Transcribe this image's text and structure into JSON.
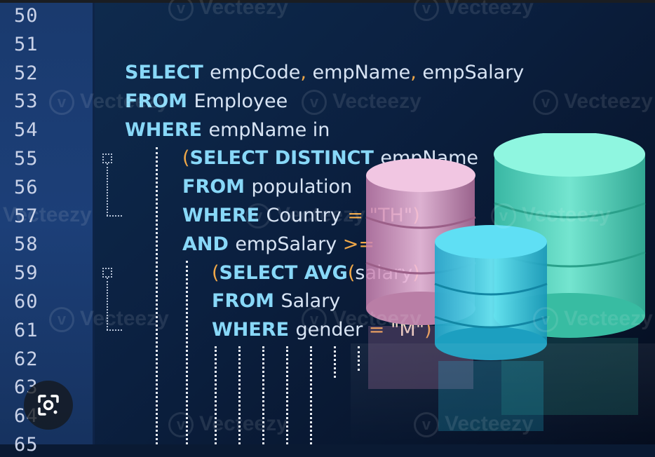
{
  "line_numbers": [
    "50",
    "51",
    "52",
    "53",
    "54",
    "55",
    "56",
    "57",
    "58",
    "59",
    "60",
    "61",
    "62",
    "63",
    "64",
    "65"
  ],
  "code_lines": [
    {
      "parts": [
        {
          "t": "SELECT ",
          "c": "kw"
        },
        {
          "t": "empCode",
          "c": "id"
        },
        {
          "t": ", ",
          "c": "op"
        },
        {
          "t": "empName",
          "c": "id"
        },
        {
          "t": ", ",
          "c": "op"
        },
        {
          "t": "empSalary",
          "c": "id"
        }
      ]
    },
    {
      "parts": [
        {
          "t": "FROM ",
          "c": "kw"
        },
        {
          "t": "Employee",
          "c": "id"
        }
      ]
    },
    {
      "parts": [
        {
          "t": "WHERE ",
          "c": "kw"
        },
        {
          "t": "empName in",
          "c": "id"
        }
      ]
    },
    {
      "parts": [
        {
          "t": "(",
          "c": "op"
        },
        {
          "t": "SELECT DISTINCT ",
          "c": "kw"
        },
        {
          "t": "empName",
          "c": "id"
        }
      ]
    },
    {
      "parts": [
        {
          "t": "FROM ",
          "c": "kw"
        },
        {
          "t": "population",
          "c": "id"
        }
      ]
    },
    {
      "parts": [
        {
          "t": "WHERE ",
          "c": "kw"
        },
        {
          "t": "Country ",
          "c": "id"
        },
        {
          "t": "= ",
          "c": "op"
        },
        {
          "t": "\"TH\"",
          "c": "str"
        },
        {
          "t": ")",
          "c": "op"
        }
      ]
    },
    {
      "parts": [
        {
          "t": "AND ",
          "c": "kw"
        },
        {
          "t": "empSalary ",
          "c": "id"
        },
        {
          "t": ">=",
          "c": "op"
        }
      ]
    },
    {
      "parts": [
        {
          "t": "(",
          "c": "op"
        },
        {
          "t": "SELECT AVG",
          "c": "kw"
        },
        {
          "t": "(",
          "c": "op"
        },
        {
          "t": "salary",
          "c": "id"
        },
        {
          "t": ")",
          "c": "op"
        }
      ]
    },
    {
      "parts": [
        {
          "t": "FROM ",
          "c": "kw"
        },
        {
          "t": "Salary",
          "c": "id"
        }
      ]
    },
    {
      "parts": [
        {
          "t": "WHERE ",
          "c": "kw"
        },
        {
          "t": "gender ",
          "c": "id"
        },
        {
          "t": "= ",
          "c": "op"
        },
        {
          "t": "\"M\"",
          "c": "str"
        },
        {
          "t": ")",
          "c": "op"
        }
      ]
    }
  ],
  "watermark": {
    "text": "Vecteezy",
    "logo_glyph": "v"
  },
  "icons": {
    "lens": "google-lens-icon",
    "fold": "fold-toggle-icon"
  },
  "colors": {
    "keyword": "#88d8f8",
    "operator": "#f0a848",
    "string": "#f4e0c4",
    "cylinder_pink": "#e9a7cf",
    "cylinder_blue": "#4fd8ea",
    "cylinder_teal": "#63e5cc"
  }
}
